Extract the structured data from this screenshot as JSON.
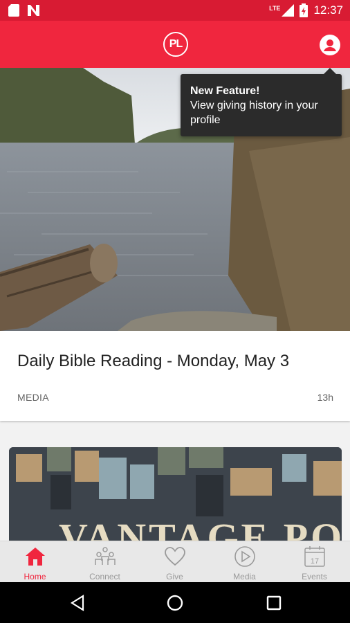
{
  "status_bar": {
    "network": "LTE",
    "time": "12:37",
    "notification_icons": [
      "sd-card-icon",
      "n-app-icon"
    ]
  },
  "app_bar": {
    "logo_text": "PL",
    "profile_icon": "profile-icon"
  },
  "tooltip": {
    "title": "New Feature!",
    "message": "View giving history in your profile"
  },
  "feed": {
    "cards": [
      {
        "title": "Daily Bible Reading - Monday, May 3",
        "category": "MEDIA",
        "age": "13h"
      },
      {
        "image_text": "VANTAGE POINT"
      }
    ]
  },
  "bottom_nav": {
    "tabs": [
      {
        "label": "Home",
        "icon": "home-icon",
        "active": true
      },
      {
        "label": "Connect",
        "icon": "connect-people-icon",
        "active": false
      },
      {
        "label": "Give",
        "icon": "heart-icon",
        "active": false
      },
      {
        "label": "Media",
        "icon": "play-circle-icon",
        "active": false
      },
      {
        "label": "Events",
        "icon": "calendar-icon",
        "active": false,
        "calendar_day": "17"
      }
    ]
  },
  "colors": {
    "brand": "#f0263e",
    "status_bar": "#d81b33",
    "tooltip_bg": "#2b2b2b"
  }
}
